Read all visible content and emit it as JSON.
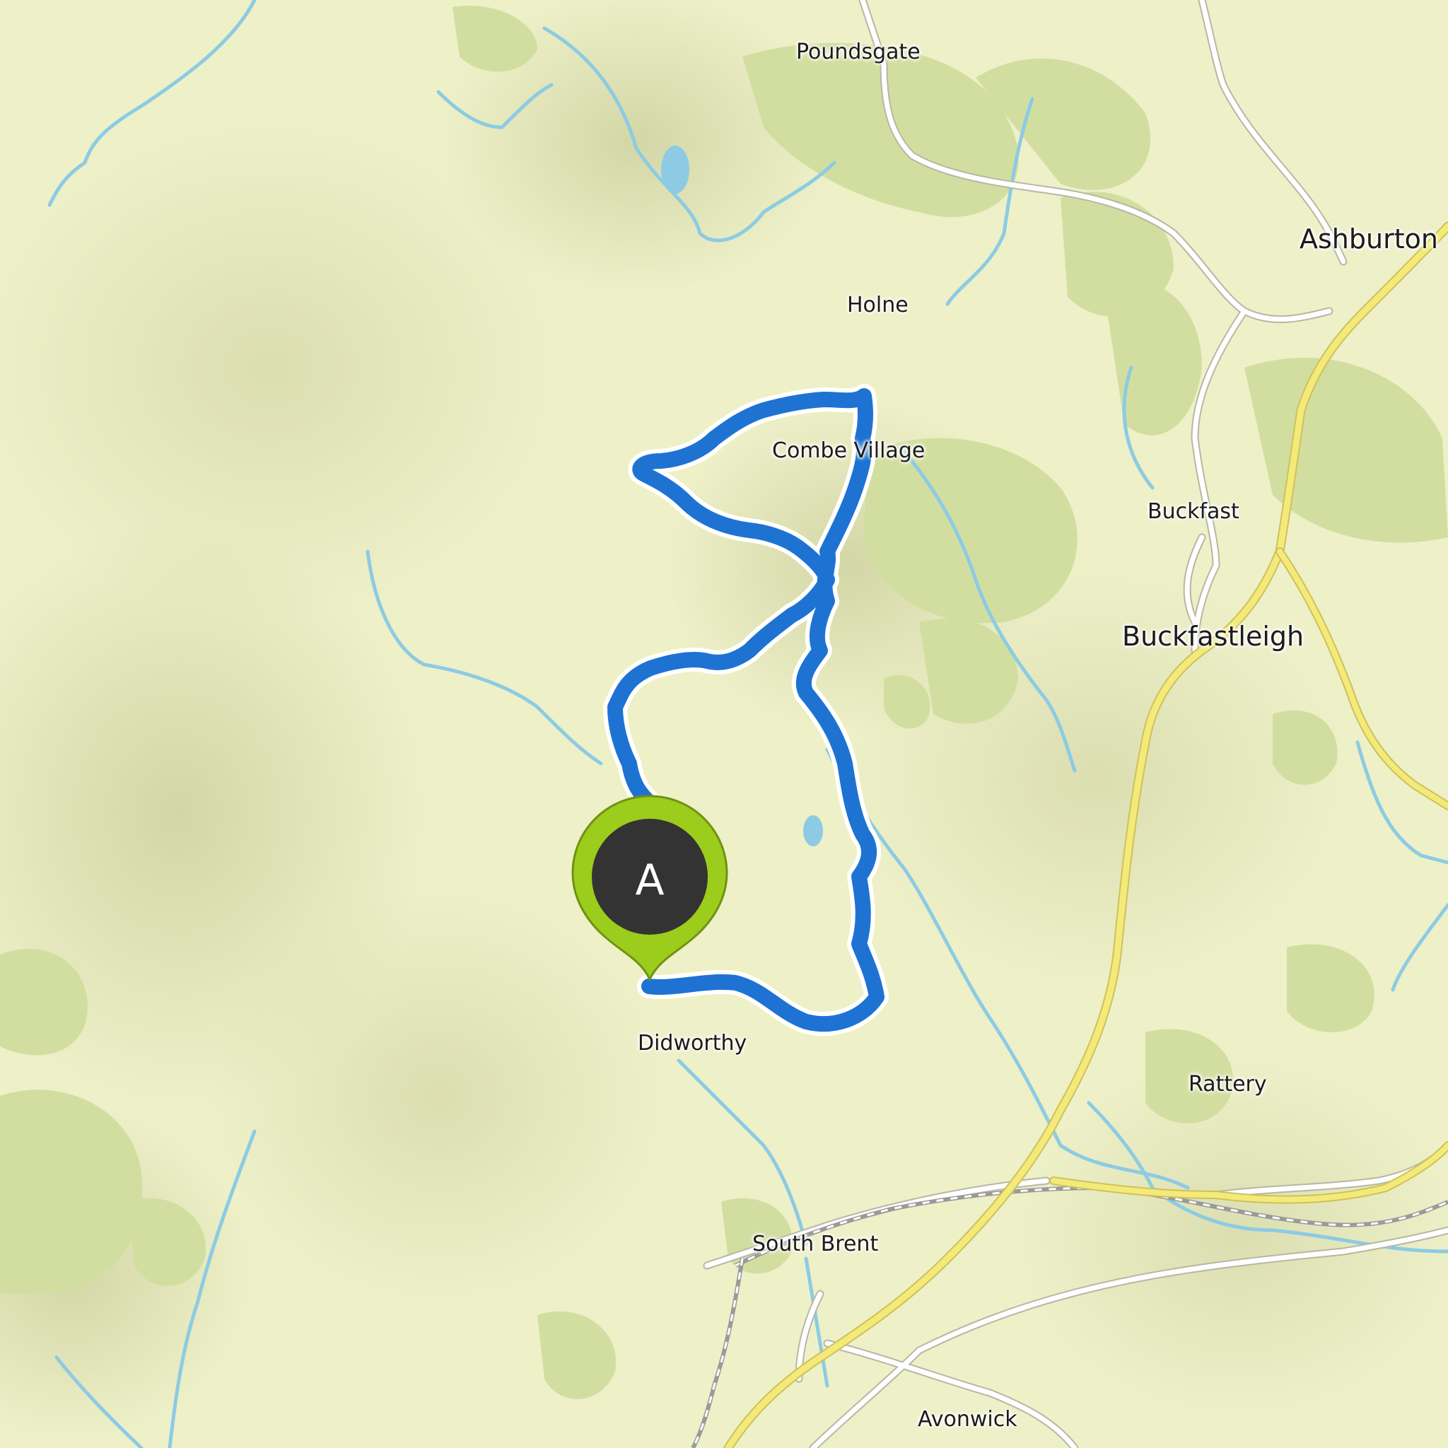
{
  "map": {
    "places": [
      {
        "id": "poundsgate",
        "name": "Poundsgate",
        "kind": "village"
      },
      {
        "id": "ashburton",
        "name": "Ashburton",
        "kind": "town"
      },
      {
        "id": "holne",
        "name": "Holne",
        "kind": "village"
      },
      {
        "id": "combe-village",
        "name": "Combe Village",
        "kind": "village"
      },
      {
        "id": "buckfast",
        "name": "Buckfast",
        "kind": "village"
      },
      {
        "id": "buckfastleigh",
        "name": "Buckfastleigh",
        "kind": "town"
      },
      {
        "id": "didworthy",
        "name": "Didworthy",
        "kind": "village"
      },
      {
        "id": "rattery",
        "name": "Rattery",
        "kind": "village"
      },
      {
        "id": "south-brent",
        "name": "South Brent",
        "kind": "village"
      },
      {
        "id": "avonwick",
        "name": "Avonwick",
        "kind": "village"
      }
    ],
    "start_marker": {
      "label": "A",
      "fill": "#333333",
      "ring": "#9ccc1c",
      "icon": "map-pin-icon"
    },
    "colors": {
      "terrain": "#eef0c8",
      "woodland": "#d2dea0",
      "water": "#8ccbe3",
      "minor_road": "#ffffff",
      "major_road": "#f3ea7a",
      "route": "#1e73d2",
      "route_halo": "#ffffff"
    }
  }
}
